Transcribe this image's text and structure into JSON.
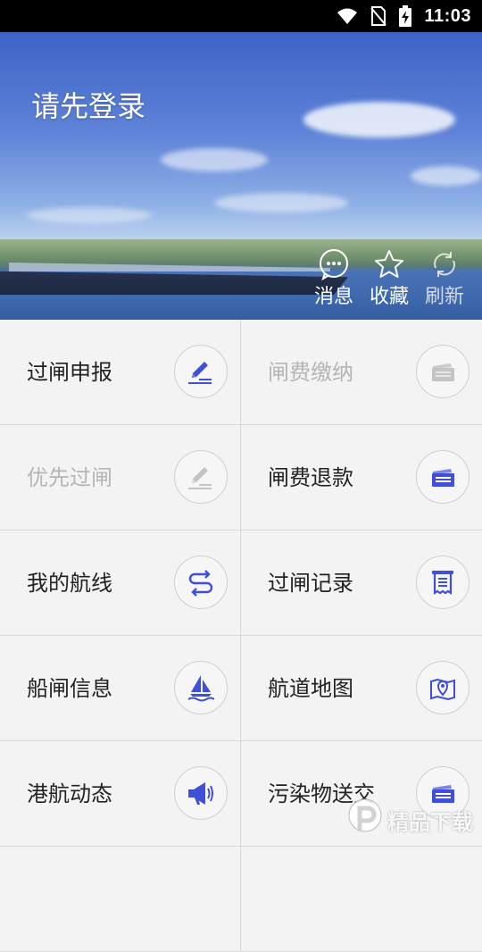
{
  "status_bar": {
    "time": "11:03",
    "icons": [
      "wifi-icon",
      "no-sim-icon",
      "battery-charging-icon"
    ]
  },
  "header": {
    "login_prompt": "请先登录",
    "actions": [
      {
        "label": "消息",
        "icon": "message-icon"
      },
      {
        "label": "收藏",
        "icon": "star-icon"
      },
      {
        "label": "刷新",
        "icon": "refresh-icon"
      }
    ]
  },
  "menu": {
    "items": [
      {
        "label": "过闸申报",
        "icon": "edit-icon",
        "enabled": true
      },
      {
        "label": "闸费缴纳",
        "icon": "ticket-icon",
        "enabled": false
      },
      {
        "label": "优先过闸",
        "icon": "edit-icon",
        "enabled": false
      },
      {
        "label": "闸费退款",
        "icon": "ticket-icon",
        "enabled": true
      },
      {
        "label": "我的航线",
        "icon": "route-icon",
        "enabled": true
      },
      {
        "label": "过闸记录",
        "icon": "receipt-icon",
        "enabled": true
      },
      {
        "label": "船闸信息",
        "icon": "sailboat-icon",
        "enabled": true
      },
      {
        "label": "航道地图",
        "icon": "map-icon",
        "enabled": true
      },
      {
        "label": "港航动态",
        "icon": "megaphone-icon",
        "enabled": true
      },
      {
        "label": "污染物送交",
        "icon": "ticket-icon",
        "enabled": true
      }
    ]
  },
  "watermark": {
    "text": "精品下载"
  },
  "colors": {
    "accent": "#3f4fd8",
    "disabled": "#b5b5b5"
  }
}
